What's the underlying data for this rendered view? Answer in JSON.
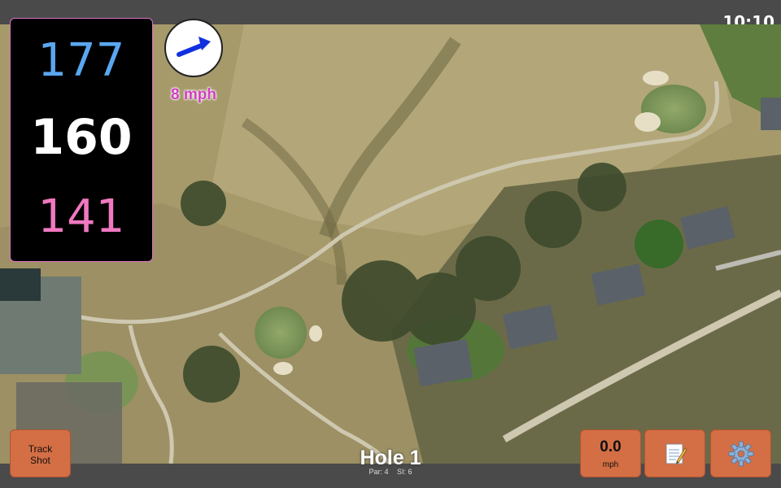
{
  "status_bar": {
    "time": "10:10"
  },
  "distances": {
    "back": "177",
    "middle": "160",
    "front": "141"
  },
  "wind": {
    "speed_label": "8 mph",
    "direction_icon": "arrow-icon"
  },
  "hole": {
    "title": "Hole 1",
    "par_label": "Par: 4",
    "si_label": "SI: 6"
  },
  "buttons": {
    "track_shot": "Track Shot",
    "speed_value": "0.0",
    "speed_unit": "mph",
    "notes_icon": "notepad-icon",
    "settings_icon": "gear-icon"
  },
  "colors": {
    "back_distance": "#5aa7f0",
    "middle_distance": "#ffffff",
    "front_distance": "#f078c0",
    "button_accent": "#d46e44",
    "wind_text": "#d040c0"
  }
}
